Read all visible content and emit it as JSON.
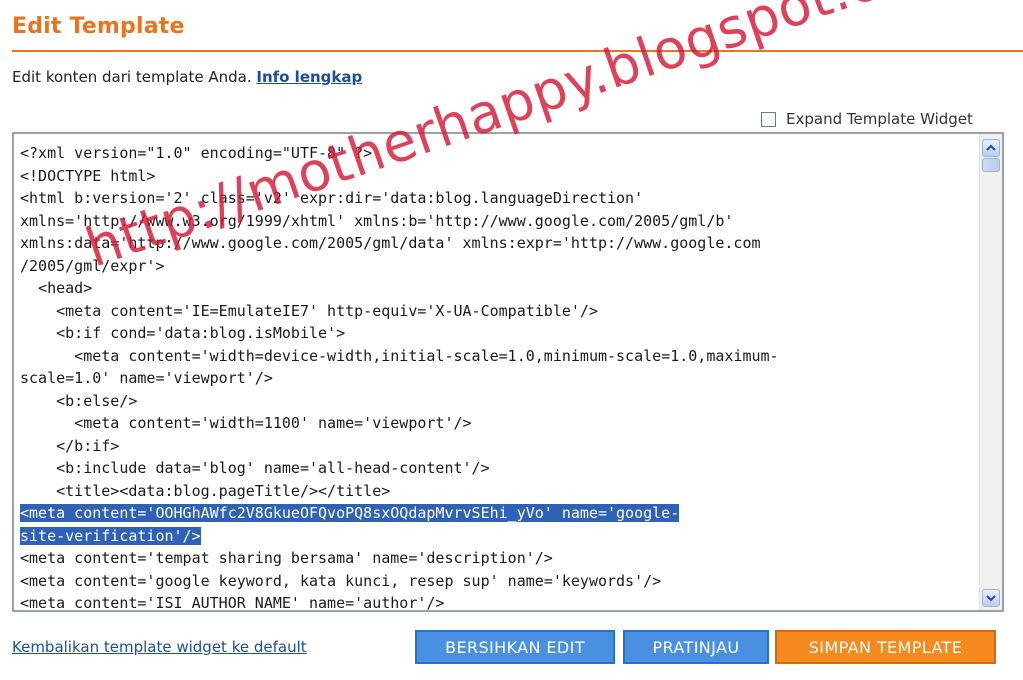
{
  "header": {
    "title": "Edit Template",
    "accent_color": "#e8741e"
  },
  "intro": {
    "text": "Edit konten dari template Anda. ",
    "link_label": "Info lengkap"
  },
  "expand_option": {
    "label": "Expand Template Widget",
    "checked": false
  },
  "editor": {
    "lines": [
      "<?xml version=\"1.0\" encoding=\"UTF-8\" ?>",
      "<!DOCTYPE html>",
      "<html b:version='2' class='v2' expr:dir='data:blog.languageDirection'",
      "xmlns='http://www.w3.org/1999/xhtml' xmlns:b='http://www.google.com/2005/gml/b'",
      "xmlns:data='http://www.google.com/2005/gml/data' xmlns:expr='http://www.google.com",
      "/2005/gml/expr'>",
      "  <head>",
      "    <meta content='IE=EmulateIE7' http-equiv='X-UA-Compatible'/>",
      "    <b:if cond='data:blog.isMobile'>",
      "      <meta content='width=device-width,initial-scale=1.0,minimum-scale=1.0,maximum-",
      "scale=1.0' name='viewport'/>",
      "    <b:else/>",
      "      <meta content='width=1100' name='viewport'/>",
      "    </b:if>",
      "    <b:include data='blog' name='all-head-content'/>",
      "    <title><data:blog.pageTitle/></title>",
      "<meta content='OOHGhAWfc2V8GkueOFQvoPQ8sxOQdapMvrvSEhi_yVo' name='google-",
      "site-verification'/>",
      "<meta content='tempat sharing bersama' name='description'/>",
      "<meta content='google keyword, kata kunci, resep sup' name='keywords'/>",
      "<meta content='ISI AUTHOR NAME' name='author'/>"
    ],
    "selected_lines": [
      16,
      17
    ],
    "selection_color": "#2f62b7"
  },
  "watermark": {
    "text": "http://motherhappy.blogspot.com/"
  },
  "footer": {
    "restore_link": "Kembalikan template widget ke default",
    "buttons": {
      "clear_label": "BERSIHKAN EDIT",
      "preview_label": "PRATINJAU",
      "save_label": "SIMPAN TEMPLATE"
    }
  }
}
